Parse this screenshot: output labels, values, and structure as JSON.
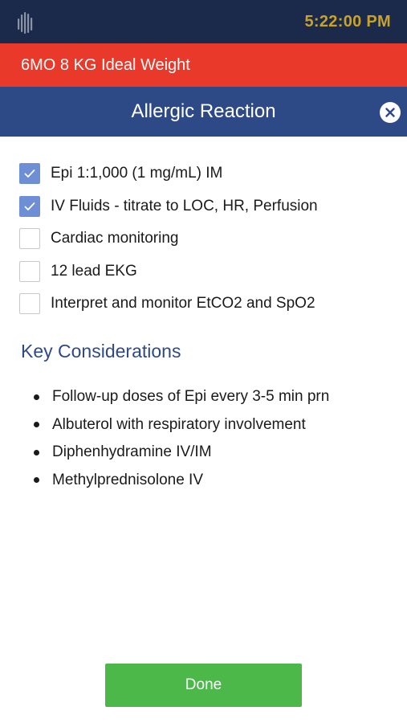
{
  "status_bar": {
    "time": "5:22:00 PM",
    "logo_icon": "hand-logo-icon"
  },
  "patient": {
    "weight_label": "6MO 8 KG Ideal Weight"
  },
  "header": {
    "title": "Allergic Reaction",
    "close_icon": "close-icon"
  },
  "checklist": [
    {
      "label": "Epi 1:1,000 (1 mg/mL) IM",
      "checked": true
    },
    {
      "label": "IV Fluids - titrate to LOC, HR, Perfusion",
      "checked": true
    },
    {
      "label": "Cardiac monitoring",
      "checked": false
    },
    {
      "label": "12 lead EKG",
      "checked": false
    },
    {
      "label": "Interpret and monitor EtCO2 and SpO2",
      "checked": false
    }
  ],
  "considerations": {
    "title": "Key Considerations",
    "items": [
      "Follow-up doses of Epi every 3-5 min prn",
      "Albuterol with respiratory involvement",
      "Diphenhydramine IV/IM",
      "Methylprednisolone IV"
    ]
  },
  "footer": {
    "done_label": "Done"
  },
  "colors": {
    "status_bar_bg": "#1b2a4a",
    "clock": "#c9a227",
    "weight_bar_bg": "#e8392b",
    "header_bg": "#2e4a86",
    "checkbox_checked": "#6e8fd6",
    "done_button": "#4cb84a"
  }
}
